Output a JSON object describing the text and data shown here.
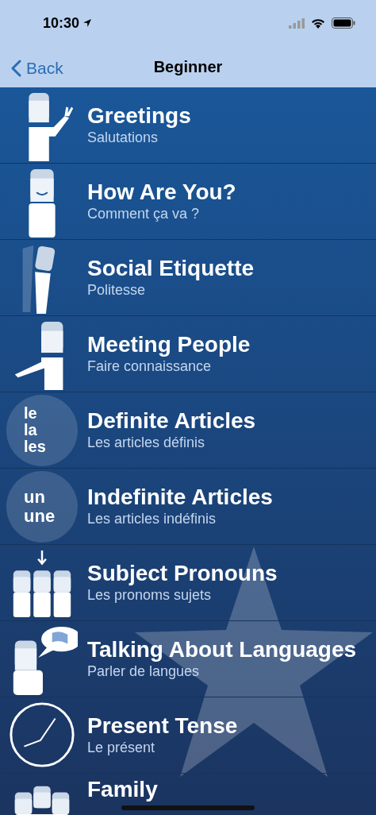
{
  "status_bar": {
    "time": "10:30"
  },
  "nav": {
    "back": "Back",
    "title": "Beginner"
  },
  "lessons": [
    {
      "title": "Greetings",
      "subtitle": "Salutations",
      "kind": "wave"
    },
    {
      "title": "How Are You?",
      "subtitle": "Comment ça va ?",
      "kind": "smile"
    },
    {
      "title": "Social Etiquette",
      "subtitle": "Politesse",
      "kind": "bow"
    },
    {
      "title": "Meeting People",
      "subtitle": "Faire connaissance",
      "kind": "reach"
    },
    {
      "title": "Definite Articles",
      "subtitle": "Les articles définis",
      "kind": "words",
      "icon_words": [
        "le",
        "la",
        "les"
      ]
    },
    {
      "title": "Indefinite Articles",
      "subtitle": "Les articles indéfinis",
      "kind": "words",
      "icon_words": [
        "un",
        "une"
      ]
    },
    {
      "title": "Subject Pronouns",
      "subtitle": "Les pronoms sujets",
      "kind": "group"
    },
    {
      "title": "Talking About Languages",
      "subtitle": "Parler de langues",
      "kind": "speech"
    },
    {
      "title": "Present Tense",
      "subtitle": "Le présent",
      "kind": "clock"
    },
    {
      "title": "Family",
      "kind": "family"
    }
  ]
}
